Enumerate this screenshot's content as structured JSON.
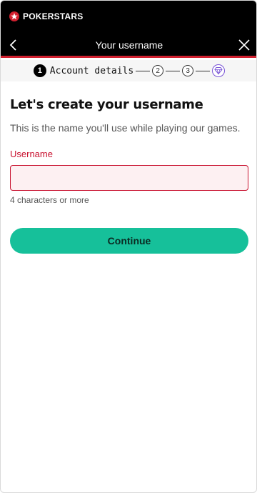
{
  "brand": {
    "name": "POKERSTARS"
  },
  "navbar": {
    "title": "Your username",
    "back_icon": "chevron-left-icon",
    "close_icon": "close-icon"
  },
  "stepper": {
    "steps": [
      {
        "number": "1",
        "label": "Account details",
        "state": "active"
      },
      {
        "number": "2",
        "state": "pending"
      },
      {
        "number": "3",
        "state": "pending"
      },
      {
        "icon": "diamond-icon",
        "state": "pending"
      }
    ]
  },
  "form": {
    "heading": "Let's create your username",
    "subtext": "This is the name you'll use while playing our games.",
    "username_label": "Username",
    "username_value": "",
    "username_hint": "4 characters or more"
  },
  "actions": {
    "continue_label": "Continue"
  },
  "colors": {
    "accent": "#16c09a",
    "error": "#c8102e",
    "brand_red": "#d1202f"
  }
}
